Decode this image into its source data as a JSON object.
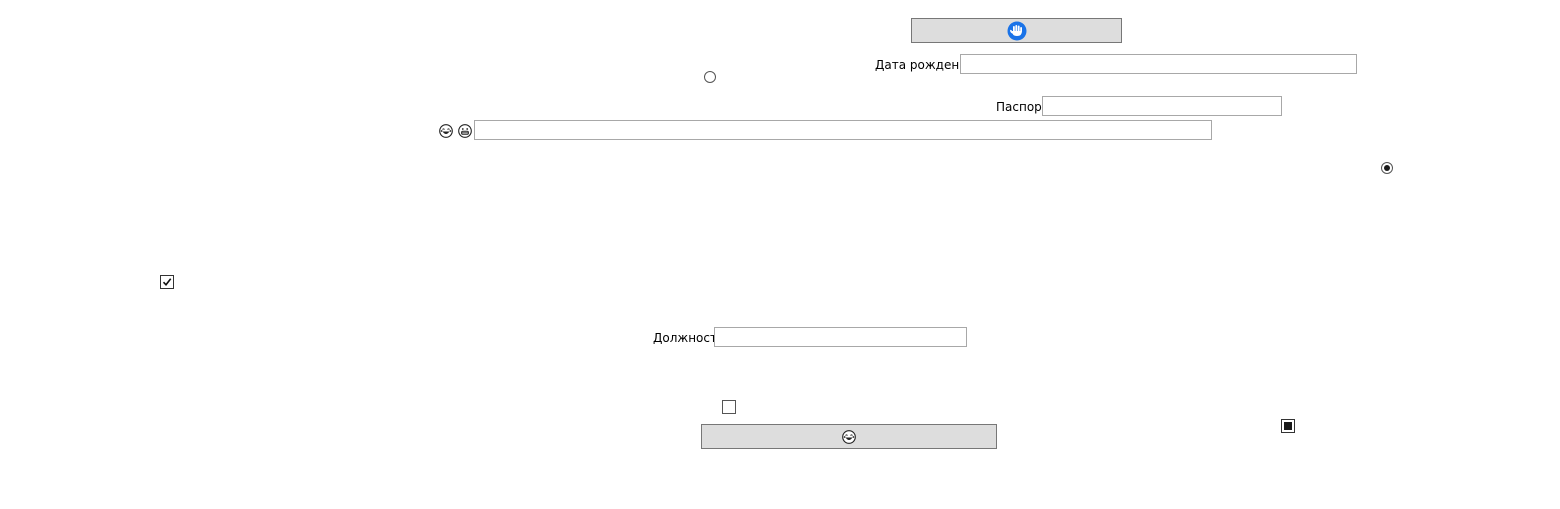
{
  "form": {
    "birth_date_label": "Дата рождения",
    "birth_date_value": "",
    "passport_label": "Паспорт",
    "passport_value": "",
    "wide_field_value": "",
    "position_label": "Должность",
    "position_value": ""
  },
  "controls": {
    "radio_left_checked": false,
    "radio_right_checked": true,
    "checkbox_left_checked": true,
    "checkbox_middle_checked": false,
    "checkbox_right_state": "indeterminate"
  },
  "icons": {
    "top_button_icon": "blue-hand-icon",
    "row_icon_1": "laughing-face-icon",
    "row_icon_2": "grinning-face-icon",
    "bottom_button_icon": "laughing-face-icon"
  },
  "colors": {
    "button_bg": "#dddddd",
    "field_border": "#a8a8a8",
    "hand_icon": "#1a73e8"
  }
}
